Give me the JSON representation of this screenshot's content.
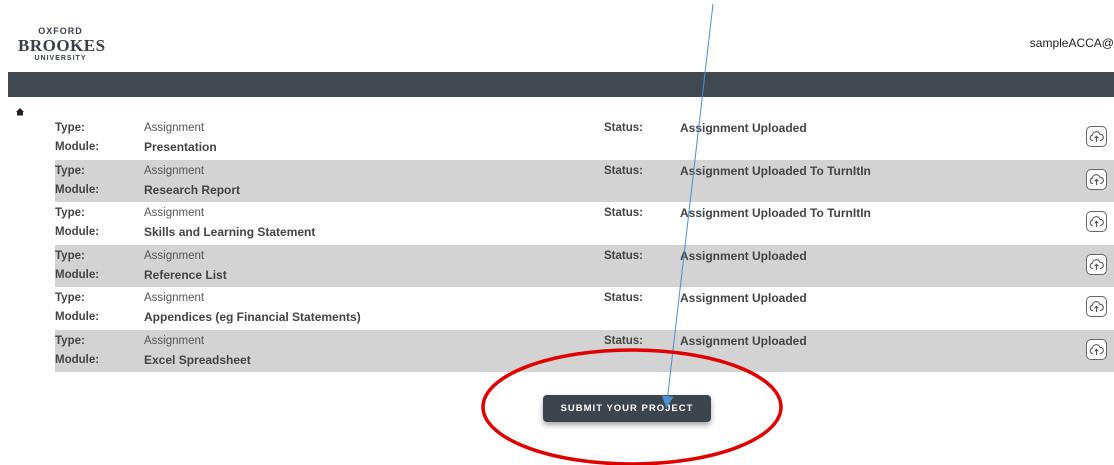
{
  "header": {
    "logo": {
      "line1": "OXFORD",
      "line2": "BROOKES",
      "line3": "UNIVERSITY"
    },
    "user": "sampleACCA@"
  },
  "labels": {
    "type": "Type:",
    "module": "Module:",
    "status": "Status:"
  },
  "rows": [
    {
      "type": "Assignment",
      "module": "Presentation",
      "status": "Assignment Uploaded"
    },
    {
      "type": "Assignment",
      "module": "Research Report",
      "status": "Assignment Uploaded To TurnItIn"
    },
    {
      "type": "Assignment",
      "module": "Skills and Learning Statement",
      "status": "Assignment Uploaded To TurnItIn"
    },
    {
      "type": "Assignment",
      "module": "Reference List",
      "status": "Assignment Uploaded"
    },
    {
      "type": "Assignment",
      "module": "Appendices (eg Financial Statements)",
      "status": "Assignment Uploaded"
    },
    {
      "type": "Assignment",
      "module": "Excel Spreadsheet",
      "status": "Assignment Uploaded"
    }
  ],
  "submit_label": "SUBMIT YOUR PROJECT",
  "icons": {
    "home": "home-icon",
    "upload": "cloud-upload-icon"
  },
  "colors": {
    "navbar": "#404850",
    "row_shade": "#d3d3d3",
    "annotation_circle": "#e00000",
    "annotation_arrow": "#4a8fd0"
  }
}
